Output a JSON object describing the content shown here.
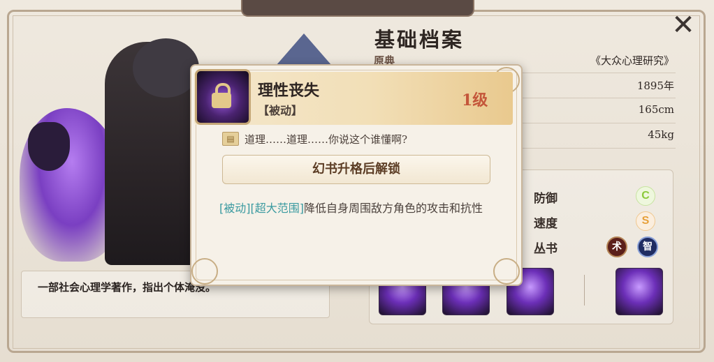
{
  "window": {
    "title": "基础档案",
    "close_icon": "crossed-swords-close-icon"
  },
  "profile": {
    "rows": [
      {
        "label": "原典",
        "value": "《大众心理研究》"
      },
      {
        "label": "",
        "value": "1895年"
      },
      {
        "label": "",
        "value": "165cm"
      },
      {
        "label": "",
        "value": "45kg"
      }
    ],
    "description": "一部社会心理学著作，指出个体淹没。"
  },
  "stats": [
    {
      "label": "防御",
      "grade": "C",
      "grade_color": "#8bc93a"
    },
    {
      "label": "速度",
      "grade": "S",
      "grade_color": "#e7a03a"
    },
    {
      "label": "丛书",
      "tags": [
        "术",
        "智"
      ]
    }
  ],
  "popup": {
    "skill_name": "理性丧失",
    "skill_type": "【被动】",
    "skill_level": "1级",
    "quote": "道理……道理……你说这个谁懂啊?",
    "unlock_label": "幻书升格后解锁",
    "effect_tags": "[被动][超大范围]",
    "effect_text": "降低自身周围敌方角色的攻击和抗性",
    "lock_icon": "lock-icon",
    "book_icon": "book-icon"
  },
  "colors": {
    "accent_teal": "#3a9aa0",
    "level_red": "#c4563a",
    "frame": "#b9a791"
  }
}
